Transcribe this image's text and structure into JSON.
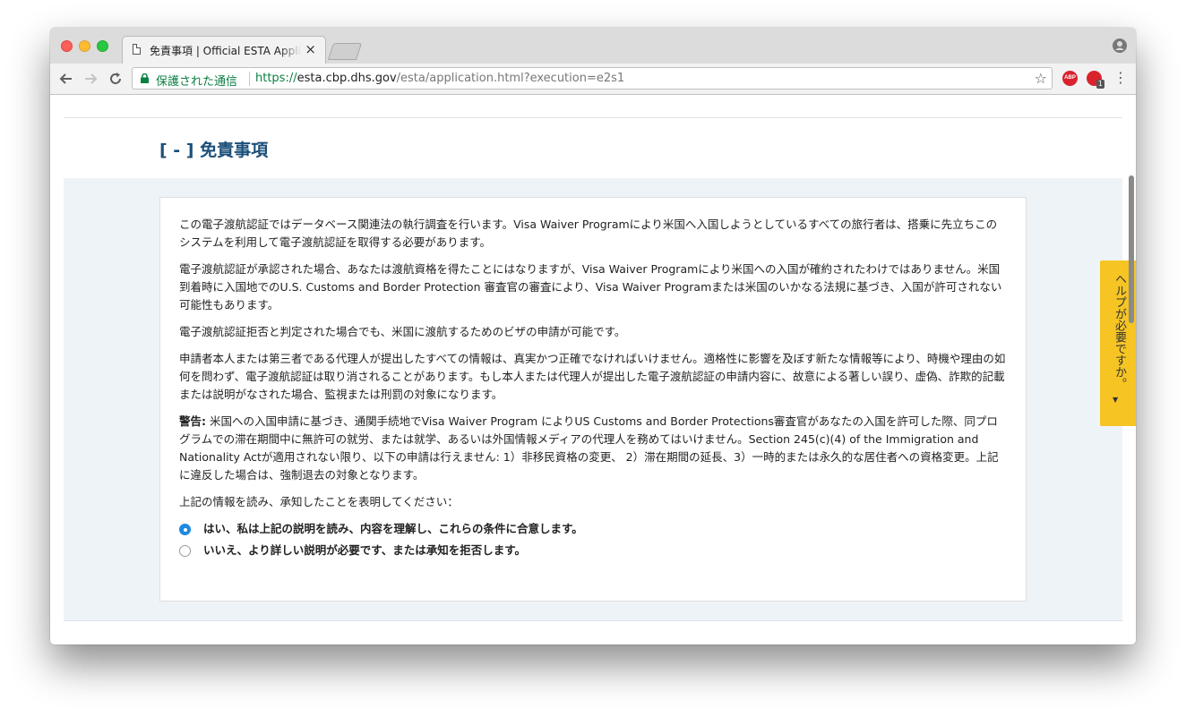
{
  "browser": {
    "tab_title": "免責事項 | Official ESTA Application",
    "tab_close": "×",
    "secure_label": "保護された通信",
    "url": {
      "scheme": "https://",
      "host": "esta.cbp.dhs.gov",
      "path": "/esta/application.html?execution=e2s1"
    },
    "ext_abp_label": "ABP",
    "ext_badge_count": "1",
    "icons": {
      "back": "back-arrow-icon",
      "forward": "forward-arrow-icon",
      "reload": "reload-icon",
      "star": "bookmark-star-icon",
      "menu": "menu-dots-icon",
      "profile": "profile-icon",
      "lock": "lock-icon"
    }
  },
  "page": {
    "section_title": "[ - ] 免責事項",
    "paragraphs": [
      "この電子渡航認証ではデータベース関連法の執行調査を行います。Visa Waiver Programにより米国へ入国しようとしているすべての旅行者は、搭乗に先立ちこのシステムを利用して電子渡航認証を取得する必要があります。",
      "電子渡航認証が承認された場合、あなたは渡航資格を得たことにはなりますが、Visa Waiver Programにより米国への入国が確約されたわけではありません。米国到着時に入国地でのU.S. Customs and Border Protection 審査官の審査により、Visa Waiver Programまたは米国のいかなる法規に基づき、入国が許可されない可能性もあります。",
      "電子渡航認証拒否と判定された場合でも、米国に渡航するためのビザの申請が可能です。",
      "申請者本人または第三者である代理人が提出したすべての情報は、真実かつ正確でなければいけません。適格性に影響を及ぼす新たな情報等により、時機や理由の如何を問わず、電子渡航認証は取り消されることがあります。もし本人または代理人が提出した電子渡航認証の申請内容に、故意による著しい誤り、虚偽、詐欺的記載または説明がなされた場合、監視または刑罰の対象になります。"
    ],
    "warning_label": "警告:",
    "warning_text": " 米国への入国申請に基づき、通関手続地でVisa Waiver Program によりUS Customs and Border Protections審査官があなたの入国を許可した際、同プログラムでの滞在期間中に無許可の就労、または就学、あるいは外国情報メディアの代理人を務めてはいけません。Section 245(c)(4) of the Immigration and Nationality Actが適用されない限り、以下の申請は行えません: 1）非移民資格の変更、 2）滞在期間の延長、3）一時的または永久的な居住者への資格変更。上記に違反した場合は、強制退去の対象となります。",
    "acknowledge_prompt": "上記の情報を読み、承知したことを表明してください：",
    "options": [
      {
        "label": "はい、私は上記の説明を読み、内容を理解し、これらの条件に合意します。",
        "selected": true
      },
      {
        "label": "いいえ、より詳しい説明が必要です、または承知を拒否します。",
        "selected": false
      }
    ],
    "help_tab_label": "ヘルプが必要ですか。",
    "help_tab_arrow": "▼"
  },
  "colors": {
    "title": "#1a4f7a",
    "secure_green": "#0b8043",
    "help_tab": "#f6c524",
    "radio_selected": "#1f8ae0",
    "panel_bg": "#eef3f8"
  }
}
